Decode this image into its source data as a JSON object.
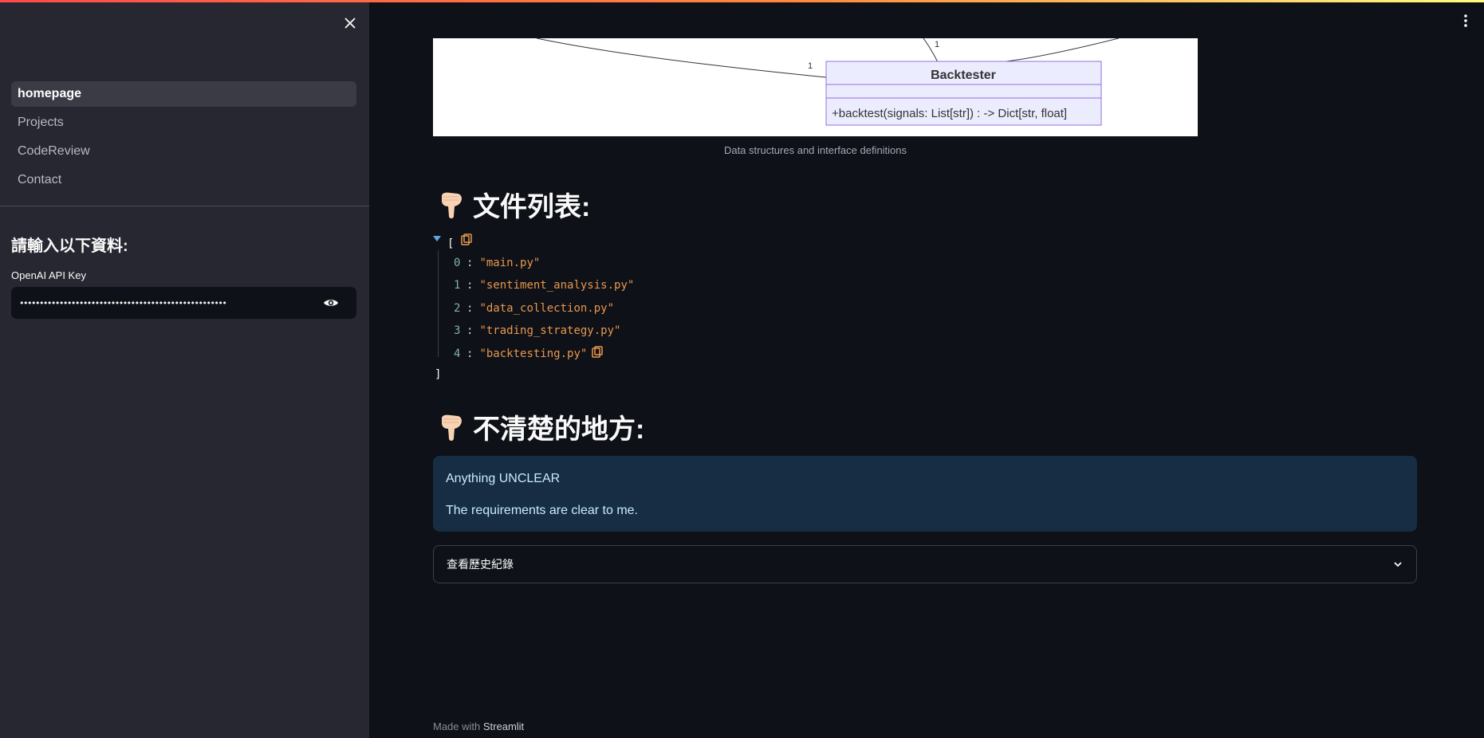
{
  "sidebar": {
    "nav": [
      {
        "label": "homepage",
        "active": true
      },
      {
        "label": "Projects",
        "active": false
      },
      {
        "label": "CodeReview",
        "active": false
      },
      {
        "label": "Contact",
        "active": false
      }
    ],
    "heading": "請輸入以下資料:",
    "api_key_label": "OpenAI API Key",
    "api_key_value": "••••••••••••••••••••••••••••••••••••••••••••••••••••"
  },
  "diagram": {
    "class_name": "Backtester",
    "method": "+backtest(signals: List[str]) : -> Dict[str, float]",
    "multiplicity_left": "1",
    "multiplicity_top": "1",
    "caption": "Data structures and interface definitions"
  },
  "file_list": {
    "title": "文件列表:",
    "open_bracket": "[",
    "close_bracket": "]",
    "items": [
      "main.py",
      "sentiment_analysis.py",
      "data_collection.py",
      "trading_strategy.py",
      "backtesting.py"
    ]
  },
  "unclear": {
    "title": "不清楚的地方:",
    "heading": "Anything UNCLEAR",
    "text": "The requirements are clear to me."
  },
  "history": {
    "label": "查看歷史紀錄"
  },
  "footer": {
    "made_with": "Made with",
    "brand": "Streamlit"
  },
  "colors": {
    "accent": "#ff4b4b",
    "sidebar_bg": "#262730",
    "main_bg": "#0e1117",
    "info_bg": "#172d43",
    "json_string": "#e8974f"
  }
}
